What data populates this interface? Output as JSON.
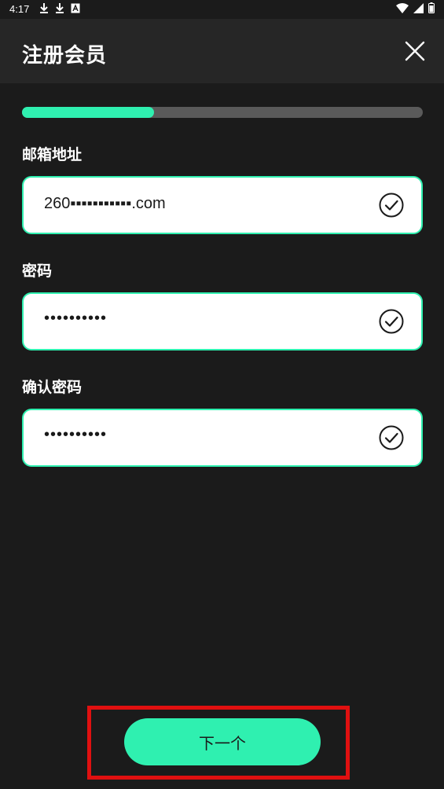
{
  "status_bar": {
    "time": "4:17",
    "left_icons": [
      "download-icon",
      "download-icon",
      "font-icon"
    ],
    "right_icons": [
      "wifi-icon",
      "signal-icon",
      "battery-icon"
    ]
  },
  "header": {
    "title": "注册会员",
    "close_icon": "close-icon"
  },
  "progress": {
    "value_fraction": 0.33,
    "fill_color": "#2ff0b0",
    "track_color": "#5a5a5a"
  },
  "form": {
    "email": {
      "label": "邮箱地址",
      "value": "260▪▪▪▪▪▪▪▪▪▪▪.com",
      "valid_icon": "check-circle-icon"
    },
    "password": {
      "label": "密码",
      "value": "••••••••••",
      "valid_icon": "check-circle-icon"
    },
    "confirm_password": {
      "label": "确认密码",
      "value": "••••••••••",
      "valid_icon": "check-circle-icon"
    }
  },
  "actions": {
    "next_label": "下一个"
  },
  "colors": {
    "accent": "#2ff0b0",
    "background": "#1b1b1b",
    "header_bg": "#262626",
    "highlight": "#e01010"
  }
}
